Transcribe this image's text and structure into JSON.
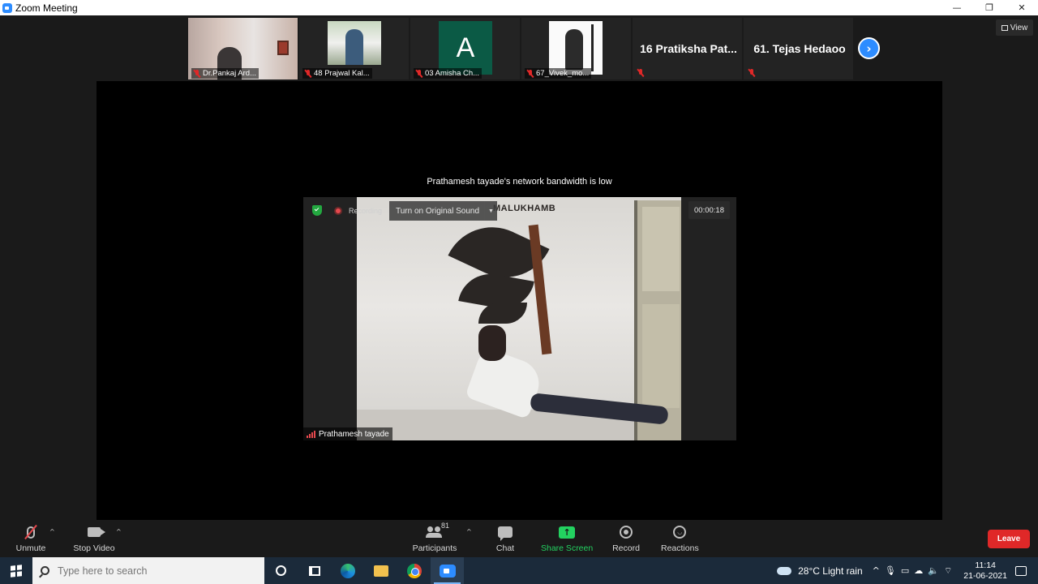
{
  "window": {
    "title": "Zoom Meeting",
    "controls": {
      "minimize": "—",
      "restore": "❐",
      "close": "✕"
    }
  },
  "thumbnails": [
    {
      "name": "Dr.Pankaj Ard...",
      "muted": true
    },
    {
      "name": "48 Prajwal Kal...",
      "muted": true
    },
    {
      "name": "03 Amisha Ch...",
      "muted": true,
      "avatar_letter": "A"
    },
    {
      "name": "67_Vivek_mo...",
      "muted": true
    },
    {
      "name": "16 Pratiksha Pat...",
      "muted": true
    },
    {
      "name": "61. Tejas Hedaoo",
      "muted": true
    }
  ],
  "view_button": "View",
  "banner": "Prathamesh tayade's network bandwidth is low",
  "video": {
    "recording_label": "Recording",
    "original_sound_button": "Turn on Original Sound",
    "timer": "00:00:18",
    "speaker_name": "Prathamesh tayade",
    "mural_text": "MALUKHAMB"
  },
  "toolbar": {
    "unmute": "Unmute",
    "stop_video": "Stop Video",
    "participants": "Participants",
    "participants_count": "81",
    "chat": "Chat",
    "share_screen": "Share Screen",
    "record": "Record",
    "reactions": "Reactions",
    "leave": "Leave"
  },
  "taskbar": {
    "search_placeholder": "Type here to search",
    "weather": "28°C  Light rain",
    "time": "11:14",
    "date": "21-06-2021"
  },
  "colors": {
    "zoom_blue": "#2d8cff",
    "share_green": "#23d160",
    "leave_red": "#e02828",
    "mute_red": "#e5484d"
  }
}
